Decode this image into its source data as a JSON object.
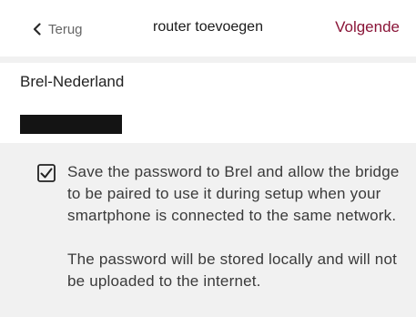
{
  "navbar": {
    "back_label": "Terug",
    "title": "router toevoegen",
    "next_label": "Volgende"
  },
  "network": {
    "ssid": "Brel-Nederland",
    "password_masked": true
  },
  "save_option": {
    "checked": true,
    "text": "Save the password to Brel and allow the bridge to be paired to use it during setup when your smartphone is connected to the same network.",
    "note": "The password will be stored locally and will not be uploaded to the internet."
  },
  "icons": {
    "back": "chevron-left-icon",
    "checkbox": "checkbox-checked-icon"
  },
  "colors": {
    "accent": "#8a1538",
    "background": "#f1f1f1",
    "surface": "#ffffff"
  }
}
